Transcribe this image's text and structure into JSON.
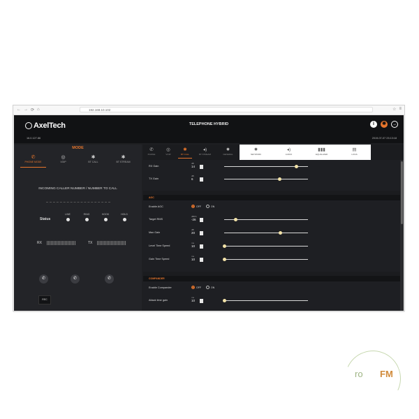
{
  "browser": {
    "address": "192.168.10.102",
    "nav_icons": [
      "←",
      "→",
      "⟳",
      "⌂"
    ],
    "right_icons": [
      "☆",
      "≡"
    ]
  },
  "header": {
    "logo_text": "AxelTech",
    "version": "16.0.127.86",
    "title": "TELEPHONE HYBRID",
    "datetime": "2019-07-07 23:13:18",
    "icons": [
      "info-icon",
      "gear-icon",
      "logout-icon"
    ]
  },
  "left": {
    "mode_title": "MODE",
    "modes": [
      {
        "label": "PHONE MODE",
        "icon": "✆",
        "active": true
      },
      {
        "label": "VOIP",
        "icon": "◎",
        "active": false
      },
      {
        "label": "BT CALL",
        "icon": "✱",
        "active": false
      },
      {
        "label": "BT STREAM",
        "icon": "✱",
        "active": false
      }
    ],
    "incoming": "INCOMING CALLER NUMBER / NUMBER TO CALL",
    "status_label": "Status",
    "status_items": [
      "LINE",
      "RING",
      "HOOK",
      "HOLD"
    ],
    "rx_label": "RX",
    "tx_label": "TX",
    "rec_label": "REC"
  },
  "right": {
    "tabs": [
      {
        "label": "PHONE",
        "icon": "✆",
        "active": false
      },
      {
        "label": "VOIP",
        "icon": "◎",
        "active": false
      },
      {
        "label": "BT CALL",
        "icon": "✱",
        "active": true
      },
      {
        "label": "BT STREAM",
        "icon": "◂)",
        "active": false
      },
      {
        "label": "GENERAL",
        "icon": "✹",
        "active": false
      },
      {
        "label": "NETWORK",
        "icon": "✹",
        "active": false
      },
      {
        "label": "AUDIO",
        "icon": "◂)",
        "active": false
      },
      {
        "label": "EQUALIZER",
        "icon": "▮▮▮",
        "active": false
      },
      {
        "label": "LOGS",
        "icon": "▤",
        "active": false
      }
    ],
    "gain_rows": [
      {
        "label": "RX Gain",
        "unit": "dB",
        "value": "14",
        "level": 0.86
      },
      {
        "label": "TX Gain",
        "unit": "dB",
        "value": "6",
        "level": 0.66
      }
    ],
    "agc": {
      "title": "AGC",
      "enable_label": "Enable AGC",
      "off_label": "OFF",
      "on_label": "ON",
      "rows": [
        {
          "label": "Target RMS",
          "unit": "dBFS",
          "value": "-26",
          "level": 0.14
        },
        {
          "label": "Max Gain",
          "unit": "dB",
          "value": "20",
          "level": 0.67
        },
        {
          "label": "Level Time Speed",
          "unit": "ms",
          "value": "10",
          "level": 0.0
        },
        {
          "label": "Gain Time Speed",
          "unit": "ms",
          "value": "10",
          "level": 0.0
        }
      ]
    },
    "compander": {
      "title": "COMPANDER",
      "enable_label": "Enable Compander",
      "off_label": "OFF",
      "on_label": "ON",
      "rows": [
        {
          "label": "Attack time gain",
          "unit": "ms",
          "value": "10",
          "level": 0.0
        }
      ]
    }
  },
  "watermark": {
    "pro": "ro",
    "fm": "FM"
  },
  "colors": {
    "accent": "#e8762c",
    "background": "#1e1f22",
    "knob": "#f3e3a8"
  }
}
